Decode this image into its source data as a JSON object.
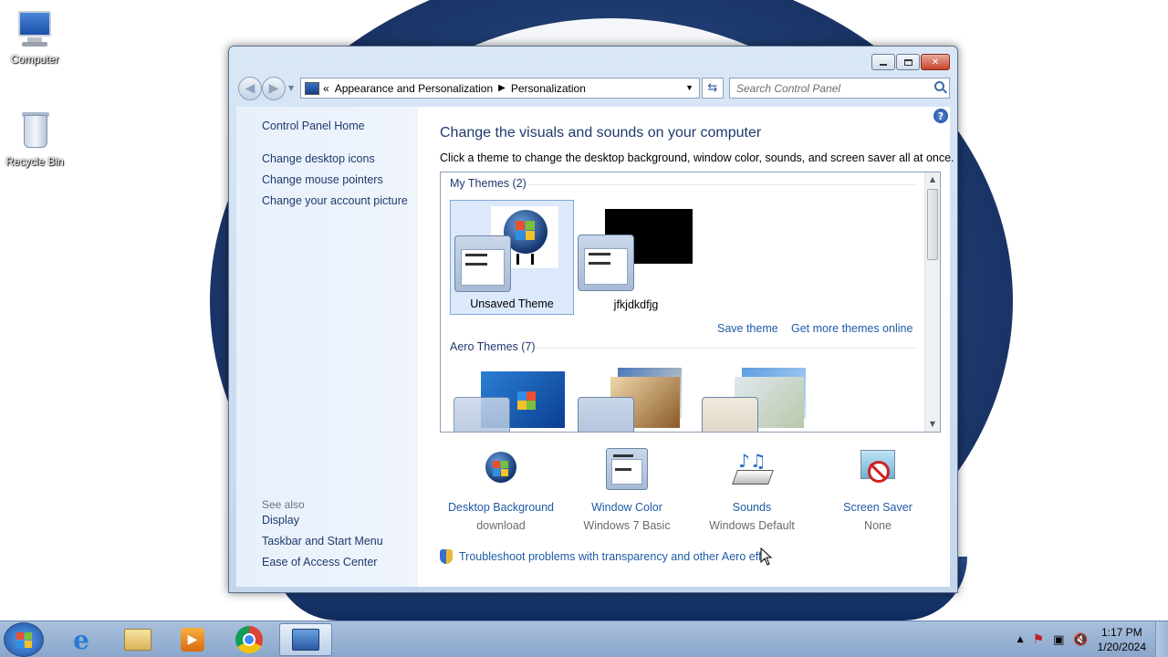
{
  "desktop": {
    "icons": [
      {
        "label": "Computer",
        "icon": "computer-icon"
      },
      {
        "label": "Recycle Bin",
        "icon": "recycle-bin-icon"
      }
    ]
  },
  "window": {
    "address": {
      "overflow": "«",
      "crumb1": "Appearance and Personalization",
      "crumb2": "Personalization"
    },
    "search_placeholder": "Search Control Panel",
    "caption": {
      "minimize": "",
      "maximize": "",
      "close": "✕"
    }
  },
  "left_panel": {
    "home": "Control Panel Home",
    "tasks": [
      "Change desktop icons",
      "Change mouse pointers",
      "Change your account picture"
    ],
    "see_also_label": "See also",
    "see_also": [
      "Display",
      "Taskbar and Start Menu",
      "Ease of Access Center"
    ]
  },
  "main": {
    "title": "Change the visuals and sounds on your computer",
    "subtitle": "Click a theme to change the desktop background, window color, sounds, and screen saver all at once.",
    "my_themes_header": "My Themes (2)",
    "my_themes": [
      {
        "name": "Unsaved Theme",
        "selected": true
      },
      {
        "name": "jfkjdkdfjg",
        "selected": false
      }
    ],
    "save_theme": "Save theme",
    "get_more": "Get more themes online",
    "aero_header": "Aero Themes (7)",
    "bottom": [
      {
        "title": "Desktop Background",
        "value": "download",
        "icon": "desktop-background-icon"
      },
      {
        "title": "Window Color",
        "value": "Windows 7 Basic",
        "icon": "window-color-icon"
      },
      {
        "title": "Sounds",
        "value": "Windows Default",
        "icon": "sounds-icon"
      },
      {
        "title": "Screen Saver",
        "value": "None",
        "icon": "screen-saver-icon"
      }
    ],
    "troubleshoot": "Troubleshoot problems with transparency and other Aero effe"
  },
  "taskbar": {
    "time": "1:17 PM",
    "date": "1/20/2024"
  },
  "colors": {
    "link": "#1e5aa6",
    "heading": "#1e3a6e",
    "taskbar": "#9ab3d6"
  }
}
